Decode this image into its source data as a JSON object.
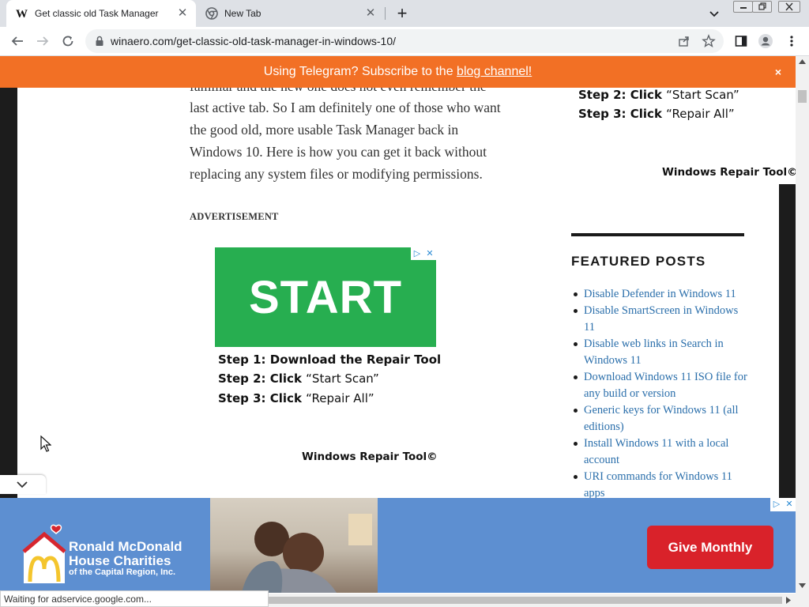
{
  "browser": {
    "tabs": [
      {
        "title": "Get classic old Task Manager in W",
        "favicon": "winaero-w-icon",
        "active": true
      },
      {
        "title": "New Tab",
        "favicon": "chrome-icon",
        "active": false
      }
    ],
    "address": "winaero.com/get-classic-old-task-manager-in-windows-10/",
    "status_text": "Waiting for adservice.google.com..."
  },
  "promo": {
    "text": "Using Telegram? Subscribe to the ",
    "link": "blog channel!",
    "close": "×"
  },
  "article": {
    "cut_line": "familiar and the new one does not even remember the",
    "lines": [
      "last active tab. So I am definitely one of those who want",
      "the good old, more usable Task Manager back in",
      "Windows 10. Here is how you can get it back without",
      "replacing any system files or modifying permissions."
    ],
    "ad_label": "ADVERTISEMENT"
  },
  "center_ad": {
    "headline": "START",
    "step1_bold": "Step 1: Download the Repair Tool",
    "step2_bold": "Step 2: Click ",
    "step2_rest": "“Start Scan”",
    "step3_bold": "Step 3: Click ",
    "step3_rest": "“Repair All”",
    "brand": "Windows Repair Tool©",
    "badge_play": "▷",
    "badge_close": "✕"
  },
  "sidebar_ad": {
    "step2_bold": "Step 2: Click ",
    "step2_rest": "“Start Scan”",
    "step3_bold": "Step 3: Click ",
    "step3_rest": "“Repair All”",
    "brand": "Windows Repair Tool©"
  },
  "featured": {
    "heading": "FEATURED POSTS",
    "items": [
      "Disable Defender in Windows 11",
      "Disable SmartScreen in Windows 11",
      "Disable web links in Search in Windows 11",
      "Download Windows 11 ISO file for any build or version",
      "Generic keys for Windows 11 (all editions)",
      "Install Windows 11 with a local account",
      "URI commands for Windows 11 apps"
    ]
  },
  "banner": {
    "org_line1": "Ronald McDonald",
    "org_line2": "House Charities",
    "org_sub": "of the Capital Region, Inc.",
    "cta": "Give Monthly",
    "badge_play": "▷",
    "badge_close": "✕"
  },
  "colors": {
    "promo_bar": "#f27025",
    "ad_green": "#27ae50",
    "banner_blue": "#5d8fd1",
    "cta_red": "#d9222a",
    "link_blue": "#2b6fab"
  }
}
